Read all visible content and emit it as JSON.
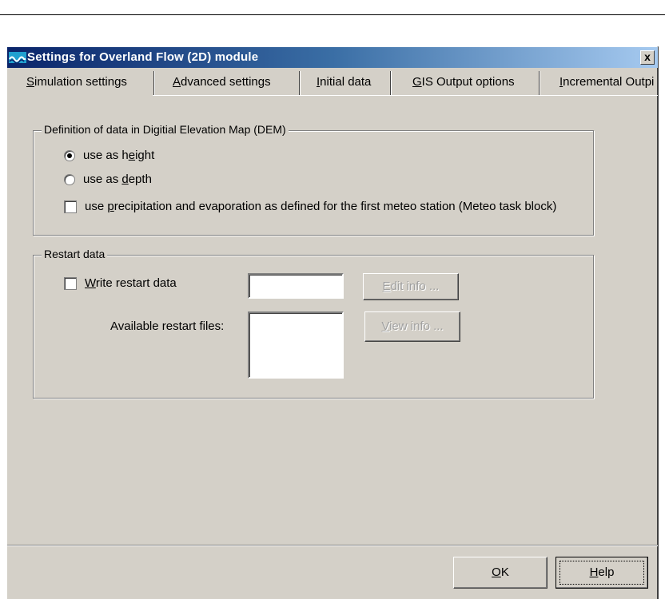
{
  "window": {
    "title": "Settings for Overland Flow (2D) module",
    "close_label": "x"
  },
  "tabs": [
    {
      "pre": "",
      "key": "S",
      "post": "imulation settings"
    },
    {
      "pre": "",
      "key": "A",
      "post": "dvanced settings"
    },
    {
      "pre": "",
      "key": "I",
      "post": "nitial data"
    },
    {
      "pre": "",
      "key": "G",
      "post": "IS Output options"
    },
    {
      "pre": "",
      "key": "I",
      "post": "ncremental Outpi"
    }
  ],
  "dem_group": {
    "label": "Definition of data in Digitial Elevation Map (DEM)",
    "radio_height": {
      "pre": "use as h",
      "key": "e",
      "post": "ight"
    },
    "radio_depth": {
      "pre": "use as ",
      "key": "d",
      "post": "epth"
    },
    "precip": {
      "pre": "use ",
      "key": "p",
      "post": "recipitation and evaporation as defined for the first meteo station (Meteo task block)"
    }
  },
  "restart_group": {
    "label": "Restart data",
    "write": {
      "pre": "",
      "key": "W",
      "post": "rite restart data"
    },
    "available_label": "Available restart files:",
    "edit_info": {
      "pre": "",
      "key": "E",
      "post": "dit info ..."
    },
    "view_info": {
      "pre": "",
      "key": "V",
      "post": "iew info ..."
    }
  },
  "buttons": {
    "ok": {
      "pre": "",
      "key": "O",
      "post": "K"
    },
    "help": {
      "pre": "",
      "key": "H",
      "post": "elp"
    }
  },
  "colors": {
    "face": "#d4d0c8",
    "title_start": "#0a246a",
    "title_end": "#a6caf0"
  }
}
